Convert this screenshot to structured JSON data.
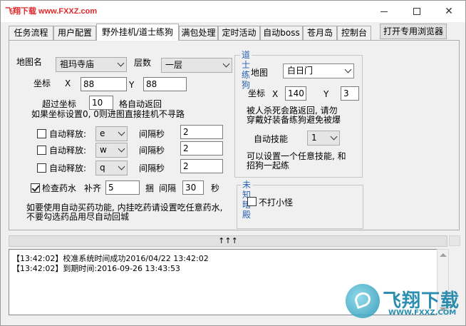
{
  "window": {
    "watermark": "飞翔下载 www.FXXZ.com",
    "controls": {
      "minimize": "—",
      "maximize": "☐",
      "close": "✕"
    }
  },
  "tabs": [
    {
      "label": "任务流程"
    },
    {
      "label": "用户配置"
    },
    {
      "label": "野外挂机/道士练狗"
    },
    {
      "label": "满包处理"
    },
    {
      "label": "定时活动"
    },
    {
      "label": "自动boss"
    },
    {
      "label": "苍月岛"
    },
    {
      "label": "控制台"
    }
  ],
  "browser_button": "打开专用浏览器",
  "left": {
    "map_label": "地图名",
    "map_value": "祖玛寺庙",
    "floor_label": "层数",
    "floor_value": "一层",
    "coord_label": "坐标",
    "x_label": "X",
    "x_value": "88",
    "y_label": "Y",
    "y_value": "88",
    "exceed_label": "超过坐标",
    "exceed_value": "10",
    "exceed_suffix": "格自动返回",
    "coord_note": "如果坐标设置0, 0则进图直接挂机不寻路",
    "auto_cast": [
      {
        "label": "自动释放:",
        "key": "e",
        "interval_label": "间隔秒",
        "interval": "2",
        "checked": false
      },
      {
        "label": "自动释放:",
        "key": "w",
        "interval_label": "间隔秒",
        "interval": "2",
        "checked": false
      },
      {
        "label": "自动释放:",
        "key": "q",
        "interval_label": "间隔秒",
        "interval": "2",
        "checked": false
      }
    ],
    "potion": {
      "label": "检查药水",
      "checked": true,
      "restock_label": "补齐",
      "restock_value": "5",
      "unit": "捆",
      "interval_label": "间隔",
      "interval_value": "30",
      "seconds": "秒"
    },
    "potion_note_1": "如要使用自动买药功能, 内挂吃药请设置吃任意药水,",
    "potion_note_2": "不要勾选药品用尽自动回城"
  },
  "taoist": {
    "title": "道士练狗",
    "map_label": "地图",
    "map_value": "白日门",
    "coord_label": "坐标",
    "x_label": "X",
    "x_value": "140",
    "y_label": "Y",
    "y_value": "3",
    "note_1": "被人杀死会路返回, 请勿",
    "note_2": "穿戴好装备练狗避免被爆",
    "skill_label": "自动技能",
    "skill_value": "1",
    "note_3": "可以设置一个任意技能, 和",
    "note_4": "招狗一起练"
  },
  "unknown": {
    "title": "未知暗殿",
    "option_label": "不打小怪",
    "checked": false
  },
  "expand_bar": "↑↑↑",
  "log": [
    "【13:42:02】校准系统时间成功2016/04/22 13:42:02",
    "【13:42:02】到期时间:2016-09-26 13:43:53"
  ],
  "corner_logo": {
    "text": "飞翔下载",
    "sub": "WWW.FXXZ.COM"
  }
}
